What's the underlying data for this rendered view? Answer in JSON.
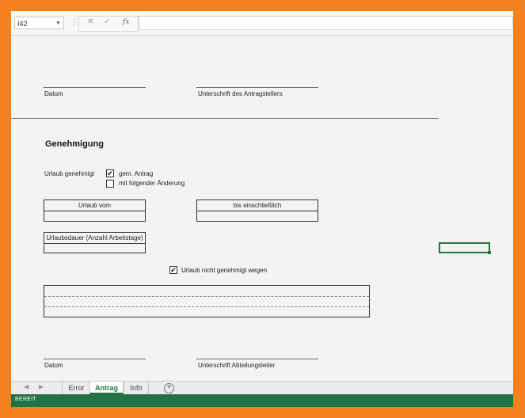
{
  "formula_bar": {
    "name_box": "I42",
    "separator": "⋮",
    "cancel_icon": "✕",
    "enter_icon": "✓",
    "function_label": "fx",
    "formula_value": ""
  },
  "sheet": {
    "signature_top": {
      "date_label": "Datum",
      "signature_label": "Unterschrift des Antragstellers"
    },
    "approval": {
      "heading": "Genehmigung",
      "leave_approved_label": "Urlaub genehmigt",
      "options": [
        {
          "label": "gem. Antrag",
          "checked": true
        },
        {
          "label": "mit folgender Änderung",
          "checked": false
        }
      ],
      "from_label": "Urlaub vom",
      "until_label": "bis einschließlich",
      "duration_label": "Urlaubsdauer (Anzahl Arbeitstage)",
      "not_approved": {
        "label": "Urlaub nicht genehmigt wegen",
        "checked": true
      }
    },
    "signature_bottom": {
      "date_label": "Datum",
      "signature_label": "Unterschrift Abteilungsleiter"
    },
    "check_mark": "✔"
  },
  "tabs": {
    "items": [
      {
        "label": "Error",
        "active": false
      },
      {
        "label": "Antrag",
        "active": true
      },
      {
        "label": "Info",
        "active": false
      }
    ],
    "add_icon": "+",
    "prev_icon": "◀",
    "next_icon": "▶"
  },
  "status_bar": {
    "status": "BEREIT"
  },
  "colors": {
    "accent": "#217346",
    "frame": "#f5821f"
  }
}
